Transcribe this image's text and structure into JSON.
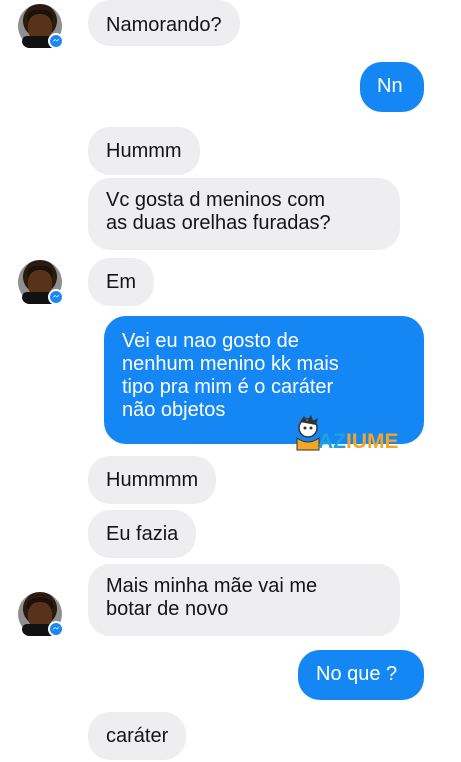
{
  "conversation": {
    "messages": [
      {
        "sender": "contact",
        "text": "Namorando?"
      },
      {
        "sender": "me",
        "text": "Nn"
      },
      {
        "sender": "contact",
        "text": "Hummm"
      },
      {
        "sender": "contact",
        "text": "Vc gosta d meninos com\nas duas orelhas furadas?"
      },
      {
        "sender": "contact",
        "text": "Em"
      },
      {
        "sender": "me",
        "text": "Vei eu nao gosto de\nnenhum menino kk mais\ntipo pra mim é o caráter\nnão objetos"
      },
      {
        "sender": "contact",
        "text": "Hummmm"
      },
      {
        "sender": "contact",
        "text": "Eu fazia"
      },
      {
        "sender": "contact",
        "text": "Mais minha mãe vai me\nbotar de novo"
      },
      {
        "sender": "me",
        "text": "No que ?"
      },
      {
        "sender": "contact",
        "text": "caráter"
      }
    ]
  },
  "watermark": {
    "brand_part1": "AZ",
    "brand_part2": "IUME",
    "color1": "#1fa2e0",
    "color2": "#f5a623"
  },
  "colors": {
    "outgoing": "#1487f4",
    "incoming": "#eeeef0",
    "messenger_badge": "#1a87f4"
  },
  "icons": {
    "avatar": "contact-avatar",
    "badge": "messenger-icon"
  }
}
